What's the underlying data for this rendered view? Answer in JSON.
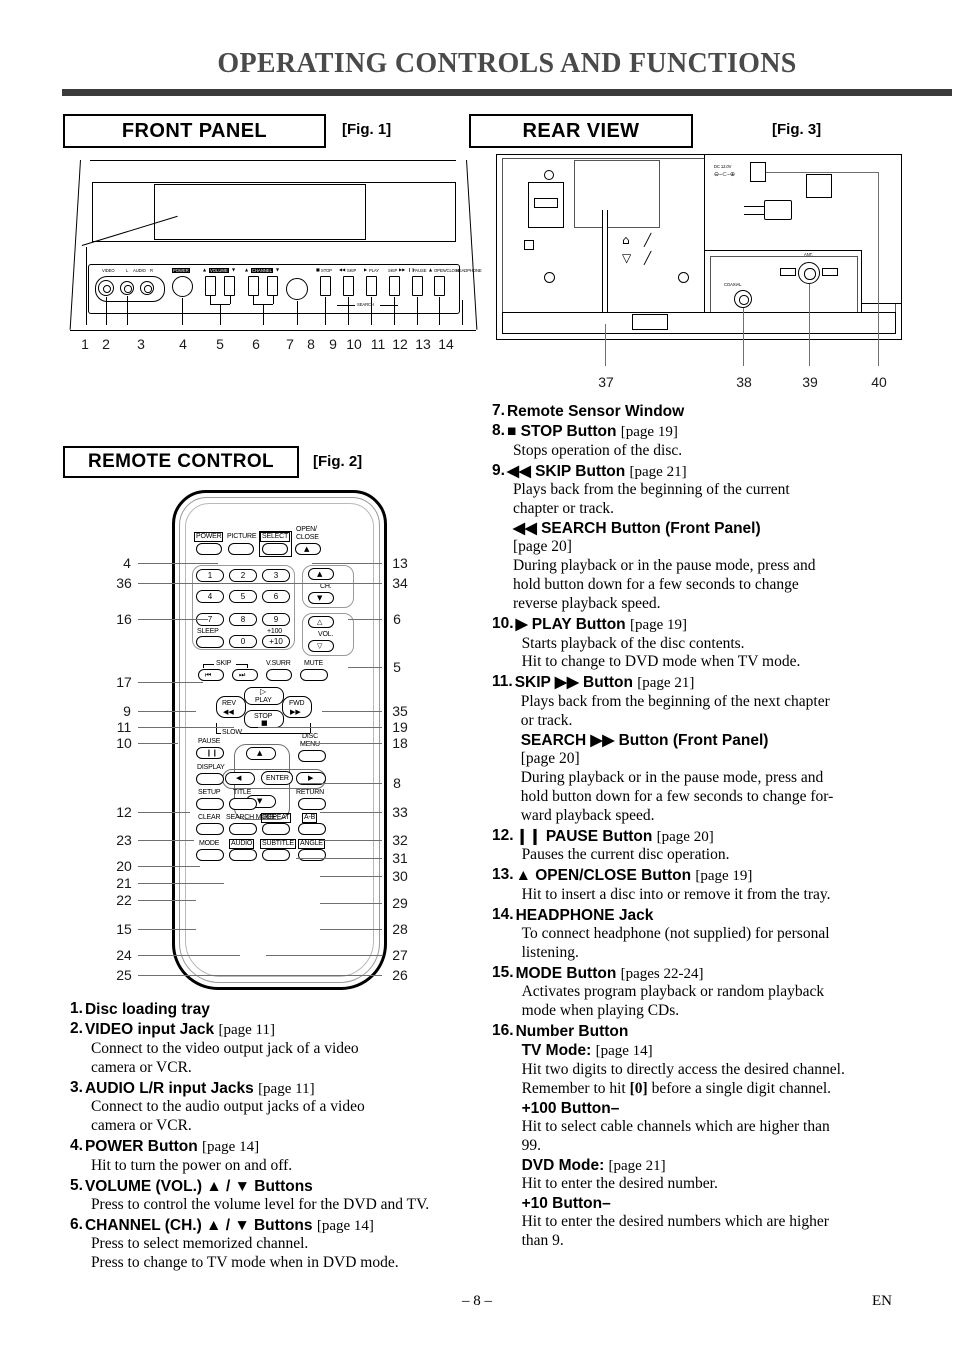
{
  "header": {
    "title": "OPERATING CONTROLS AND FUNCTIONS"
  },
  "sections": {
    "front_panel": {
      "label": "FRONT PANEL",
      "fig": "[Fig. 1]"
    },
    "rear_view": {
      "label": "REAR VIEW",
      "fig": "[Fig. 3]"
    },
    "remote": {
      "label": "REMOTE CONTROL",
      "fig": "[Fig. 2]"
    }
  },
  "front_panel_diagram": {
    "callout_numbers": [
      "1",
      "2",
      "3",
      "4",
      "5",
      "6",
      "7",
      "8",
      "9",
      "10",
      "11",
      "12",
      "13",
      "14"
    ],
    "labels": {
      "video": "VIDEO",
      "audio": "AUDIO",
      "audio_l": "L",
      "audio_r": "R",
      "power": "POWER",
      "volume": "VOLUME",
      "channel": "CHANNEL",
      "stop": "STOP",
      "skip_prev": "SKIP",
      "play": "PLAY",
      "skip_next": "SKIP",
      "pause": "PAUSE",
      "open_close": "OPEN/CLOSE",
      "headphone": "HEADPHONE",
      "search": "SEARCH"
    }
  },
  "rear_view_diagram": {
    "callout_numbers": [
      "37",
      "38",
      "39",
      "40"
    ],
    "labels": {
      "dc_in": "DC 12.0V",
      "coaxial": "COAXIAL",
      "antenna": "ANT."
    }
  },
  "remote_diagram": {
    "left_callouts": [
      "4",
      "36",
      "16",
      "17",
      "9",
      "11",
      "10",
      "12",
      "23",
      "20",
      "21",
      "22",
      "15",
      "24",
      "25"
    ],
    "right_callouts": [
      "13",
      "34",
      "6",
      "5",
      "35",
      "19",
      "18",
      "8",
      "33",
      "32",
      "31",
      "30",
      "29",
      "28",
      "27",
      "26"
    ],
    "keys": {
      "power": "POWER",
      "picture": "PICTURE",
      "select": "SELECT",
      "open_close_1": "OPEN/",
      "open_close_2": "CLOSE",
      "num_1": "1",
      "num_2": "2",
      "num_3": "3",
      "num_4": "4",
      "num_5": "5",
      "num_6": "6",
      "num_7": "7",
      "num_8": "8",
      "num_9": "9",
      "num_0": "0",
      "sleep": "SLEEP",
      "plus100": "+100",
      "plus10": "+10",
      "ch": "CH.",
      "vol": "VOL.",
      "skip": "SKIP",
      "vsurr": "V.SURR",
      "mute": "MUTE",
      "play": "PLAY",
      "rev": "REV",
      "fwd": "FWD",
      "stop": "STOP",
      "slow": "SLOW",
      "pause": "PAUSE",
      "disc_menu_1": "DISC",
      "disc_menu_2": "MENU",
      "display": "DISPLAY",
      "enter": "ENTER",
      "setup": "SETUP",
      "title": "TITLE",
      "return": "RETURN",
      "clear": "CLEAR",
      "search_mode": "SEARCH MODE",
      "repeat": "REPEAT",
      "ab": "A-B",
      "mode": "MODE",
      "audio": "AUDIO",
      "subtitle": "SUBTITLE",
      "angle": "ANGLE"
    }
  },
  "list_left": [
    {
      "num": "1.",
      "title": "Disc loading tray",
      "page": "",
      "lines": []
    },
    {
      "num": "2.",
      "title": "VIDEO input Jack",
      "page": "[page 11]",
      "lines": [
        "Connect to the video output jack of a video",
        "camera or VCR."
      ]
    },
    {
      "num": "3.",
      "title": "AUDIO L/R input Jacks",
      "page": "[page 11]",
      "lines": [
        "Connect to the audio output jacks of a video",
        "camera or VCR."
      ]
    },
    {
      "num": "4.",
      "title": "POWER Button",
      "page": "[page 14]",
      "lines": [
        "Hit to turn the power on and off."
      ]
    },
    {
      "num": "5.",
      "title": "VOLUME (VOL.) ▲ / ▼ Buttons",
      "page": "",
      "lines": [
        "Press to control the volume level for the DVD and TV."
      ]
    },
    {
      "num": "6.",
      "title": "CHANNEL (CH.) ▲ / ▼ Buttons",
      "page": "[page 14]",
      "lines": [
        "Press to select memorized channel.",
        "Press to change to TV mode when in DVD mode."
      ]
    }
  ],
  "list_right": [
    {
      "num": "7.",
      "title": "Remote Sensor Window",
      "page": "",
      "lines": []
    },
    {
      "num": "8.",
      "title": "■ STOP Button",
      "page": "[page 19]",
      "lines": [
        "Stops operation of the disc."
      ]
    },
    {
      "num": "9.",
      "title": "◀◀ SKIP Button",
      "page": "[page 21]",
      "lines": [
        "Plays back from the beginning of the current",
        "chapter or track."
      ],
      "sub": {
        "title": "◀◀ SEARCH Button (Front Panel)",
        "page": "[page 20]",
        "lines": [
          "During playback or in the pause mode, press and",
          "hold button down for a few seconds to change",
          "reverse playback speed."
        ]
      }
    },
    {
      "num": "10.",
      "title": "▶ PLAY Button",
      "page": "[page 19]",
      "lines": [
        "Starts playback of the disc contents.",
        "Hit to change to DVD mode when TV mode."
      ]
    },
    {
      "num": "11.",
      "title": "SKIP ▶▶ Button",
      "page": "[page 21]",
      "lines": [
        "Plays back from the beginning of the next chapter",
        "or track."
      ],
      "sub": {
        "title": "SEARCH ▶▶ Button (Front Panel)",
        "page": "[page 20]",
        "lines": [
          "During playback or in the pause mode, press and",
          "hold button down for a few seconds to change for-",
          "ward playback speed."
        ]
      }
    },
    {
      "num": "12.",
      "title": "❙❙ PAUSE Button",
      "page": "[page 20]",
      "lines": [
        "Pauses the current disc operation."
      ]
    },
    {
      "num": "13.",
      "title": "▲ OPEN/CLOSE Button",
      "page": "[page 19]",
      "lines": [
        "Hit to insert a disc into or remove it from the tray."
      ]
    },
    {
      "num": "14.",
      "title": "HEADPHONE Jack",
      "page": "",
      "lines": [
        "To connect headphone (not supplied) for personal",
        "listening."
      ]
    },
    {
      "num": "15.",
      "title": "MODE Button",
      "page": "[pages 22-24]",
      "lines": [
        "Activates program playback or random playback",
        "mode when playing CDs."
      ]
    },
    {
      "num": "16.",
      "title": "Number Button",
      "page": "",
      "lines": [],
      "blocks": [
        {
          "title": "TV Mode:",
          "page": "[page 14]",
          "lines": [
            "Hit two digits to directly access the desired channel.",
            "Remember to hit [0] before a single digit channel."
          ]
        },
        {
          "title": "+100 Button–",
          "page": "",
          "lines": [
            "Hit to select cable channels which are higher than",
            "99."
          ]
        },
        {
          "title": "DVD Mode:",
          "page": "[page 21]",
          "lines": [
            "Hit to enter the desired number."
          ]
        },
        {
          "title": "+10 Button–",
          "page": "",
          "lines": [
            "Hit to enter the desired numbers which are higher",
            "than 9."
          ]
        }
      ]
    }
  ],
  "footer": {
    "page_number": "– 8 –",
    "language": "EN"
  }
}
